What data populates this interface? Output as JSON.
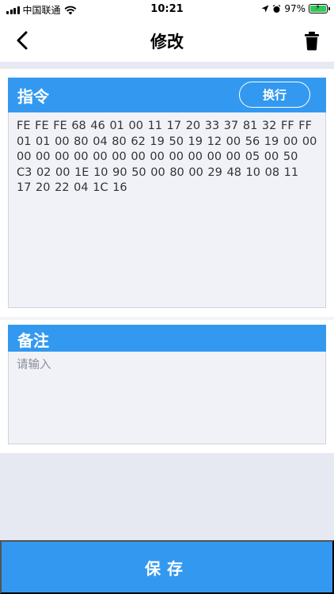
{
  "status_bar": {
    "carrier": "中国联通",
    "time": "10:21",
    "battery": "97%"
  },
  "nav": {
    "title": "修改"
  },
  "command_section": {
    "title": "指令",
    "wrap_button": "换行",
    "value": "FE FE FE 68 46 01 00 11 17 20 33 37 81 32 FF FF 01 01 00 80 04 80 62 19 50 19 12 00 56 19 00 00 00 00 00 00 00 00 00 00 00 00 00 00 05 00 50 C3 02 00 1E 10 90 50 00 80 00 29 48 10 08 11 17 20 22 04 1C 16"
  },
  "remark_section": {
    "title": "备注",
    "placeholder": "请输入"
  },
  "save_button": "保存",
  "colors": {
    "accent": "#3399f0",
    "page_background": "#e6e9f1",
    "field_background": "#f0f2f7"
  }
}
